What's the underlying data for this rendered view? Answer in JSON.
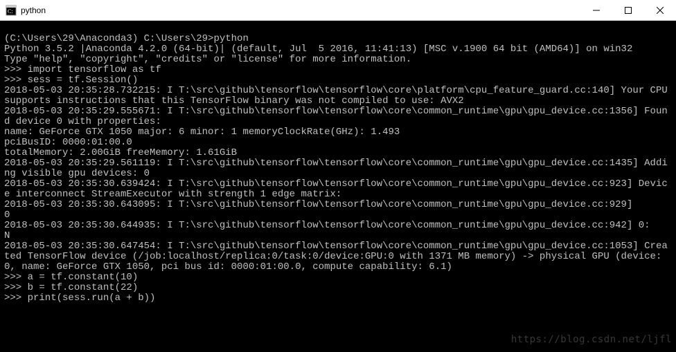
{
  "window": {
    "title": "python",
    "minimize": "—",
    "maximize": "□",
    "close": "×"
  },
  "terminal": {
    "lines": [
      "",
      "(C:\\Users\\29\\Anaconda3) C:\\Users\\29>python",
      "Python 3.5.2 |Anaconda 4.2.0 (64-bit)| (default, Jul  5 2016, 11:41:13) [MSC v.1900 64 bit (AMD64)] on win32",
      "Type \"help\", \"copyright\", \"credits\" or \"license\" for more information.",
      ">>> import tensorflow as tf",
      ">>> sess = tf.Session()",
      "2018-05-03 20:35:28.732215: I T:\\src\\github\\tensorflow\\tensorflow\\core\\platform\\cpu_feature_guard.cc:140] Your CPU supports instructions that this TensorFlow binary was not compiled to use: AVX2",
      "2018-05-03 20:35:29.555671: I T:\\src\\github\\tensorflow\\tensorflow\\core\\common_runtime\\gpu\\gpu_device.cc:1356] Found device 0 with properties:",
      "name: GeForce GTX 1050 major: 6 minor: 1 memoryClockRate(GHz): 1.493",
      "pciBusID: 0000:01:00.0",
      "totalMemory: 2.00GiB freeMemory: 1.61GiB",
      "2018-05-03 20:35:29.561119: I T:\\src\\github\\tensorflow\\tensorflow\\core\\common_runtime\\gpu\\gpu_device.cc:1435] Adding visible gpu devices: 0",
      "2018-05-03 20:35:30.639424: I T:\\src\\github\\tensorflow\\tensorflow\\core\\common_runtime\\gpu\\gpu_device.cc:923] Device interconnect StreamExecutor with strength 1 edge matrix:",
      "2018-05-03 20:35:30.643095: I T:\\src\\github\\tensorflow\\tensorflow\\core\\common_runtime\\gpu\\gpu_device.cc:929]      0",
      "2018-05-03 20:35:30.644935: I T:\\src\\github\\tensorflow\\tensorflow\\core\\common_runtime\\gpu\\gpu_device.cc:942] 0:   N",
      "2018-05-03 20:35:30.647454: I T:\\src\\github\\tensorflow\\tensorflow\\core\\common_runtime\\gpu\\gpu_device.cc:1053] Created TensorFlow device (/job:localhost/replica:0/task:0/device:GPU:0 with 1371 MB memory) -> physical GPU (device: 0, name: GeForce GTX 1050, pci bus id: 0000:01:00.0, compute capability: 6.1)",
      ">>> a = tf.constant(10)",
      ">>> b = tf.constant(22)",
      ">>> print(sess.run(a + b))"
    ]
  },
  "watermark": "https://blog.csdn.net/ljfl"
}
